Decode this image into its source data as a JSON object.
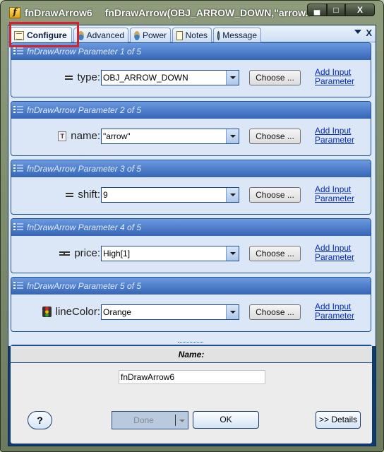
{
  "window": {
    "title_name": "fnDrawArrow6",
    "title_expression": "fnDrawArrow(OBJ_ARROW_DOWN,\"arrow...",
    "controls": {
      "minimize": "minimize",
      "maximize": "maximize",
      "close": "X"
    }
  },
  "tabs": [
    {
      "label": "Configure",
      "icon": "configure-icon",
      "active": true
    },
    {
      "label": "Advanced",
      "icon": "wizard-icon",
      "active": false
    },
    {
      "label": "Power",
      "icon": "wizard-icon",
      "active": false
    },
    {
      "label": "Notes",
      "icon": "notes-icon",
      "active": false
    },
    {
      "label": "Message",
      "icon": "globe-icon",
      "active": false
    }
  ],
  "tabstrip": {
    "menu_icon": "dropdown-triangle-icon",
    "close_icon": "X"
  },
  "parameters": [
    {
      "header": "fnDrawArrow Parameter 1 of 5",
      "label": "type:",
      "icon": "line-icon",
      "value": "OBJ_ARROW_DOWN",
      "choose_label": "Choose ...",
      "link_line1": "Add Input",
      "link_line2": "Parameter"
    },
    {
      "header": "fnDrawArrow Parameter 2 of 5",
      "label": "name:",
      "icon": "text-icon",
      "value": "\"arrow\"",
      "choose_label": "Choose ...",
      "link_line1": "Add Input",
      "link_line2": "Parameter"
    },
    {
      "header": "fnDrawArrow Parameter 3 of 5",
      "label": "shift:",
      "icon": "line-icon",
      "value": "9",
      "choose_label": "Choose ...",
      "link_line1": "Add Input",
      "link_line2": "Parameter"
    },
    {
      "header": "fnDrawArrow Parameter 4 of 5",
      "label": "price:",
      "icon": "double-line-icon",
      "value": "High[1]",
      "choose_label": "Choose ...",
      "link_line1": "Add Input",
      "link_line2": "Parameter"
    },
    {
      "header": "fnDrawArrow Parameter 5 of 5",
      "label": "lineColor:",
      "icon": "traffic-light-icon",
      "value": "Orange",
      "choose_label": "Choose ...",
      "link_line1": "Add Input",
      "link_line2": "Parameter"
    }
  ],
  "name_section": {
    "header": "Name:",
    "value": "fnDrawArrow6"
  },
  "buttons": {
    "help": "?",
    "done": "Done",
    "ok": "OK",
    "details": ">> Details"
  },
  "colors": {
    "header_blue": "#3565b5",
    "highlight_red": "#d3242c",
    "link_blue": "#0b2db5"
  }
}
